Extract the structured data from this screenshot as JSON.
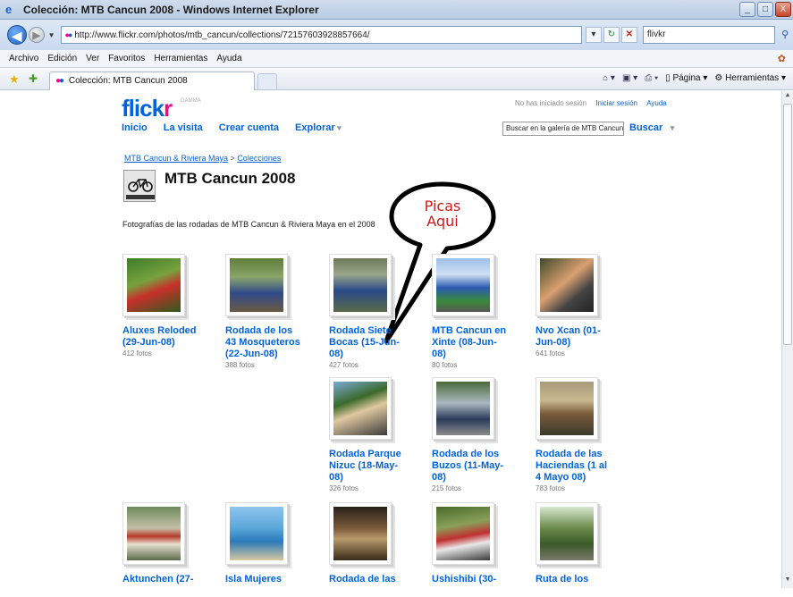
{
  "window": {
    "title": "Colección: MTB Cancun 2008 - Windows Internet Explorer",
    "controls": [
      "_",
      "□",
      "X"
    ]
  },
  "address_bar": {
    "url": "http://www.flickr.com/photos/mtb_cancun/collections/72157603928857664/",
    "search_value": "flivkr"
  },
  "menu": [
    "Archivo",
    "Edición",
    "Ver",
    "Favoritos",
    "Herramientas",
    "Ayuda"
  ],
  "tab": {
    "label": "Colección: MTB Cancun 2008"
  },
  "command_bar": {
    "page_label": "Página",
    "tools_label": "Herramientas"
  },
  "flickr": {
    "logo_text_1": "flick",
    "logo_text_2": "r",
    "logo_beta": "GAMMA",
    "nav": [
      "Inicio",
      "La visita",
      "Crear cuenta",
      "Explorar"
    ],
    "status_text": "No has iniciado sesión",
    "login_link": "Iniciar sesión",
    "help_link": "Ayuda",
    "search_placeholder": "Buscar en la galería de MTB Cancun",
    "search_button": "Buscar",
    "colors": {
      "blue": "#0063dc",
      "pink": "#ff0084"
    }
  },
  "collection": {
    "breadcrumb_link": "MTB Cancun & Riviera Maya",
    "breadcrumb_sep": " > ",
    "breadcrumb_current": "Colecciones",
    "title": "MTB Cancun 2008",
    "description": "Fotografías de las rodadas de MTB Cancun & Riviera Maya en el 2008"
  },
  "annotation": {
    "line1": "Picas",
    "line2": "Aqui"
  },
  "sets": [
    {
      "name": "Aluxes Reloded (29-Jun-08)",
      "count": "412 fotos"
    },
    {
      "name": "Rodada de los 43 Mosqueteros (22-Jun-08)",
      "count": "388 fotos"
    },
    {
      "name": "Rodada Siete Bocas (15-Jun-08)",
      "count": "427 fotos"
    },
    {
      "name": "MTB Cancun en Xinte (08-Jun-08)",
      "count": "80 fotos"
    },
    {
      "name": "Nvo Xcan (01-Jun-08)",
      "count": "641 fotos"
    },
    {
      "name": "Rodada Parque Nizuc (18-May-08)",
      "count": "326 fotos"
    },
    {
      "name": "Rodada de los Buzos (11-May-08)",
      "count": "215 fotos"
    },
    {
      "name": "Rodada de las Haciendas (1 al 4 Mayo 08)",
      "count": "783 fotos"
    },
    {
      "name": "Aktunchen (27-",
      "count": ""
    },
    {
      "name": "Isla Mujeres",
      "count": ""
    },
    {
      "name": "Rodada de las",
      "count": ""
    },
    {
      "name": "Ushishibi (30-",
      "count": ""
    },
    {
      "name": "Ruta de los",
      "count": ""
    }
  ]
}
